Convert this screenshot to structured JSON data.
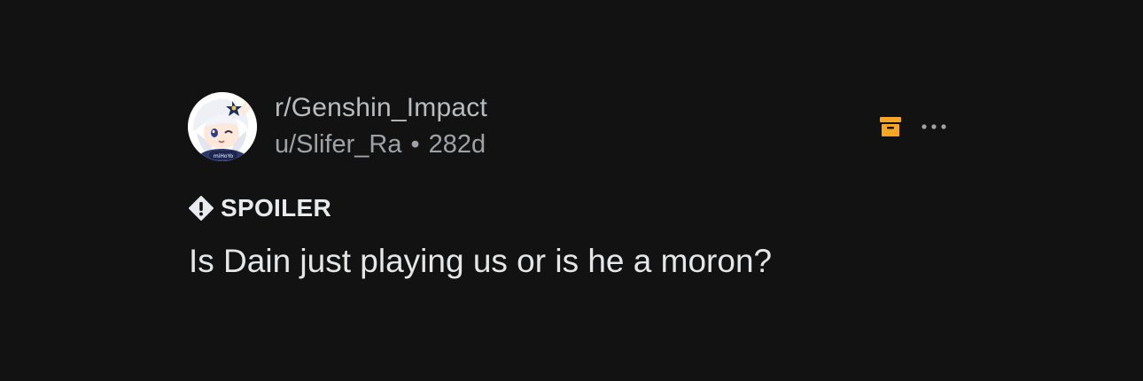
{
  "post": {
    "subreddit": "r/Genshin_Impact",
    "author": "u/Slifer_Ra",
    "separator": "•",
    "age": "282d",
    "avatar_badge_text": "miHoYo",
    "flair": "SPOILER",
    "title": "Is Dain just playing us or is he a moron?"
  },
  "icons": {
    "save": "archive-icon",
    "more": "more-dots-icon",
    "spoiler": "exclamation-shield-icon"
  },
  "colors": {
    "background": "#121212",
    "accent_save_icon": "#f5a623",
    "text_primary": "#e4e6e8",
    "text_secondary": "#9ea2a6"
  }
}
